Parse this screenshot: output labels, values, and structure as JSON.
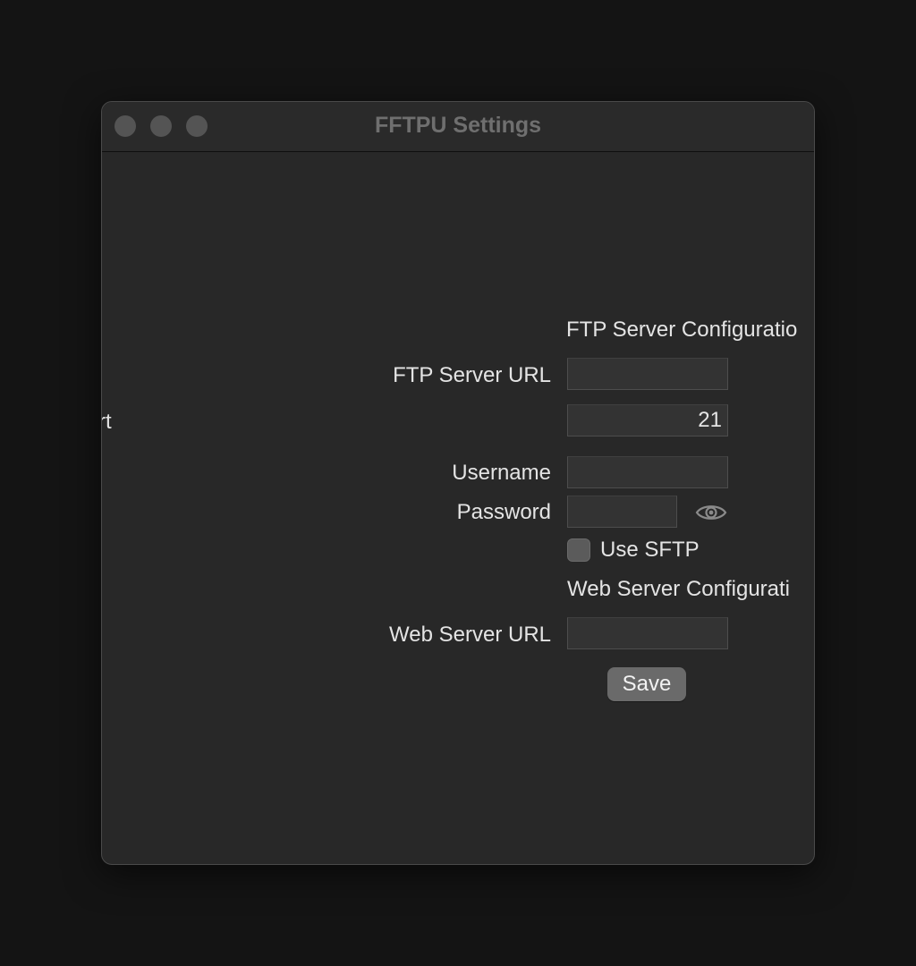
{
  "window": {
    "title": "FFTPU Settings"
  },
  "form": {
    "ftp_section_heading": "FTP Server Configuratio",
    "ftp_url_label": "FTP Server URL",
    "ftp_url_value": "",
    "port_label_clipped": "rt",
    "port_value": "21",
    "username_label": "Username",
    "username_value": "",
    "password_label": "Password",
    "password_value": "",
    "password_toggle_icon": "eye-icon",
    "use_sftp_label": "Use SFTP",
    "use_sftp_checked": false,
    "web_section_heading": "Web Server Configurati",
    "web_url_label": "Web Server URL",
    "web_url_value": "",
    "save_label": "Save"
  },
  "colors": {
    "background": "#141414",
    "window": "#282828",
    "text": "#e4e4e4",
    "button": "#6a6a6a"
  }
}
